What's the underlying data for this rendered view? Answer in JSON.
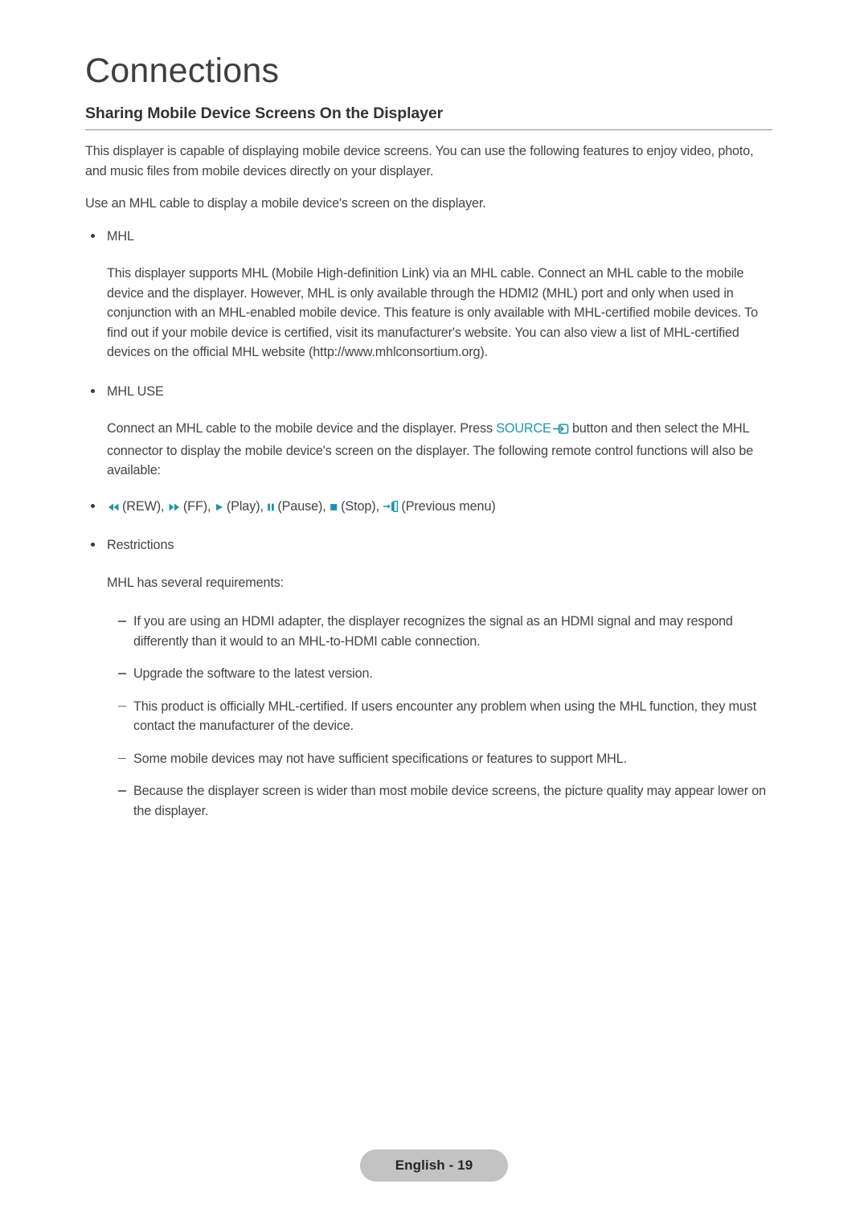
{
  "document": {
    "chapter_title": "Connections",
    "section_heading": "Sharing Mobile Device Screens On the Displayer",
    "intro_paragraph": "This displayer is capable of displaying mobile device screens. You can use the following features to enjoy video, photo, and music files from mobile devices directly on your displayer.",
    "mhl_cable_paragraph": "Use an MHL cable to display a mobile device's screen on the displayer.",
    "bullets": [
      {
        "label": "MHL",
        "body": "This displayer supports MHL (Mobile High-definition Link) via an MHL cable. Connect an MHL cable to the mobile device and the displayer. However, MHL is only available through the HDMI2 (MHL) port and only when used in conjunction with an MHL-enabled mobile device. This feature is only available with MHL-certified mobile devices. To find out if your mobile device is certified, visit its manufacturer's website. You can also view a list of MHL-certified devices on the official MHL website (http://www.mhlconsortium.org)."
      },
      {
        "label": "MHL USE",
        "body_before_source": "Connect an MHL cable to the mobile device and the displayer. Press ",
        "source_label": "SOURCE",
        "body_after_source": " button and then select the MHL connector to display the mobile device's screen on the displayer. The following remote control functions will also be available:"
      },
      {
        "label": "Restrictions",
        "body": "MHL has several requirements:"
      }
    ],
    "remote_functions": [
      {
        "icon": "rewind-icon",
        "label": "(REW),"
      },
      {
        "icon": "fast-forward-icon",
        "label": "(FF),"
      },
      {
        "icon": "play-icon",
        "label": "(Play),"
      },
      {
        "icon": "pause-icon",
        "label": "(Pause),"
      },
      {
        "icon": "stop-icon",
        "label": "(Stop),"
      },
      {
        "icon": "previous-menu-icon",
        "label": "(Previous menu)"
      }
    ],
    "restrictions": [
      "If you are using an HDMI adapter, the displayer recognizes the signal as an HDMI signal and may respond differently than it would to an MHL-to-HDMI cable connection.",
      "Upgrade the software to the latest version.",
      "This product is officially MHL-certified. If users encounter any problem when using the MHL function, they must contact the manufacturer of the device.",
      "Some mobile devices may not have sufficient specifications or features to support MHL.",
      "Because the displayer screen is wider than most mobile device screens, the picture quality may appear lower on the displayer."
    ],
    "footer": {
      "page_label": "English - 19"
    },
    "colors": {
      "accent_teal": "#1f94a9",
      "body_text": "#444444",
      "heading_text": "#333333",
      "badge_background": "#c3c3c3",
      "badge_text": "#262626",
      "rule": "#8d8d8d"
    }
  }
}
